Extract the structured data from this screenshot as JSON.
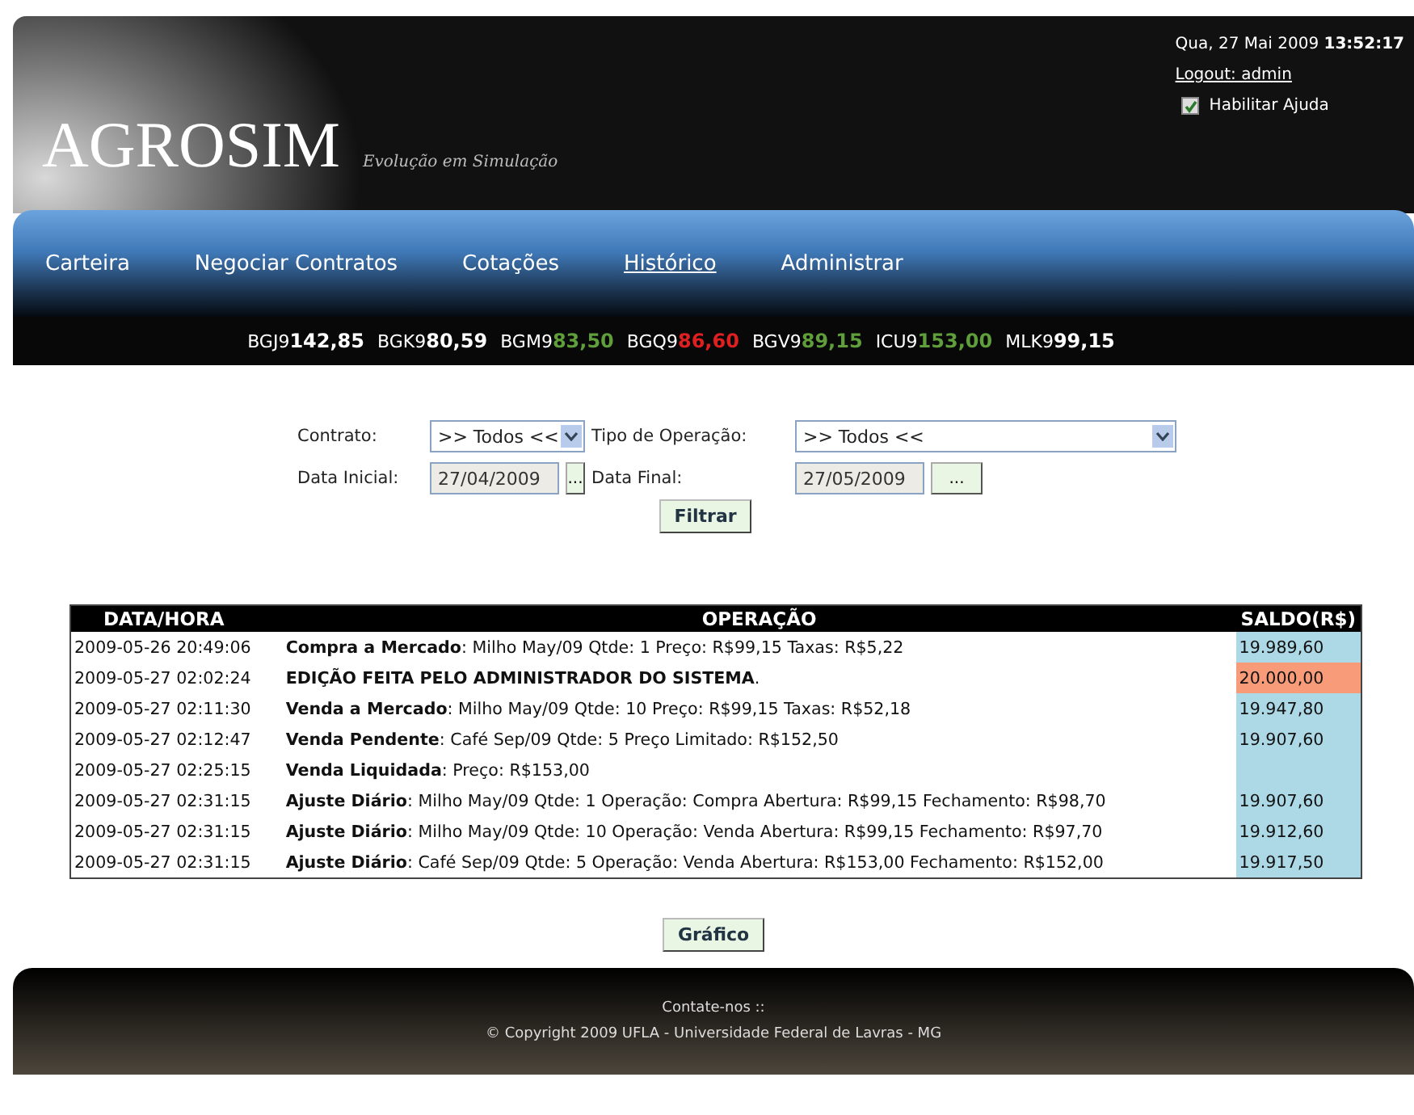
{
  "header": {
    "logo": "AGROSIM",
    "tagline": "Evolução em Simulação",
    "date": "Qua, 27 Mai 2009",
    "time": "13:52:17",
    "logout": "Logout: admin",
    "help": {
      "label": "Habilitar Ajuda",
      "checked": true
    }
  },
  "nav": [
    {
      "label": "Carteira",
      "selected": false
    },
    {
      "label": "Negociar Contratos",
      "selected": false
    },
    {
      "label": "Cotações",
      "selected": false
    },
    {
      "label": "Histórico",
      "selected": true
    },
    {
      "label": "Administrar",
      "selected": false
    }
  ],
  "ticker": [
    {
      "code": "BGJ9",
      "value": "142,85",
      "color": "#ffffff"
    },
    {
      "code": "BGK9",
      "value": "80,59",
      "color": "#ffffff"
    },
    {
      "code": "BGM9",
      "value": "83,50",
      "color": "#5f9e3a"
    },
    {
      "code": "BGQ9",
      "value": "86,60",
      "color": "#e02020"
    },
    {
      "code": "BGV9",
      "value": "89,15",
      "color": "#5f9e3a"
    },
    {
      "code": "ICU9",
      "value": "153,00",
      "color": "#5f9e3a"
    },
    {
      "code": "MLK9",
      "value": "99,15",
      "color": "#ffffff"
    }
  ],
  "filters": {
    "contrato_label": "Contrato:",
    "contrato_value": ">> Todos <<",
    "tipo_label": "Tipo de Operação:",
    "tipo_value": ">> Todos <<",
    "data_inicial_label": "Data Inicial:",
    "data_inicial": "27/04/2009",
    "data_final_label": "Data Final:",
    "data_final": "27/05/2009",
    "picker": "...",
    "filter_button": "Filtrar"
  },
  "table": {
    "columns": [
      "DATA/HORA",
      "OPERAÇÃO",
      "SALDO(R$)"
    ],
    "rows": [
      {
        "date": "2009-05-26 20:49:06",
        "operation": "**Compra a Mercado**: Milho May/09 Qtde: 1 Preço: R$99,15 Taxas: R$5,22",
        "balance": "19.989,60",
        "highlighted": false
      },
      {
        "date": "2009-05-27 02:02:24",
        "operation": "**EDIÇÃO FEITA PELO ADMINISTRADOR DO SISTEMA**.",
        "balance": "20.000,00",
        "highlighted": true
      },
      {
        "date": "2009-05-27 02:11:30",
        "operation": "**Venda a Mercado**: Milho May/09 Qtde: 10 Preço: R$99,15 Taxas: R$52,18",
        "balance": "19.947,80",
        "highlighted": false
      },
      {
        "date": "2009-05-27 02:12:47",
        "operation": "**Venda Pendente**: Café Sep/09 Qtde: 5 Preço Limitado: R$152,50",
        "balance": "19.907,60",
        "highlighted": false
      },
      {
        "date": "2009-05-27 02:25:15",
        "operation": "**Venda Liquidada**: Preço: R$153,00",
        "highlighted": false
      },
      {
        "date": "2009-05-27 02:31:15",
        "operation": "**Ajuste Diário**: Milho May/09 Qtde: 1 Operação: Compra Abertura: R$99,15 Fechamento: R$98,70",
        "balance": "19.907,60",
        "highlighted": false
      },
      {
        "date": "2009-05-27 02:31:15",
        "operation": "**Ajuste Diário**: Milho May/09 Qtde: 10 Operação: Venda Abertura: R$99,15 Fechamento: R$97,70",
        "balance": "19.912,60",
        "highlighted": false
      },
      {
        "date": "2009-05-27 02:31:15",
        "operation": "**Ajuste Diário**: Café Sep/09 Qtde: 5 Operação: Venda Abertura: R$153,00 Fechamento: R$152,00",
        "balance": "19.917,50",
        "highlighted": false
      }
    ]
  },
  "chart_button": "Gráfico",
  "footer": {
    "contact": "Contate-nos ::",
    "copyright": "© Copyright 2009 UFLA - Universidade Federal de Lavras - MG"
  }
}
